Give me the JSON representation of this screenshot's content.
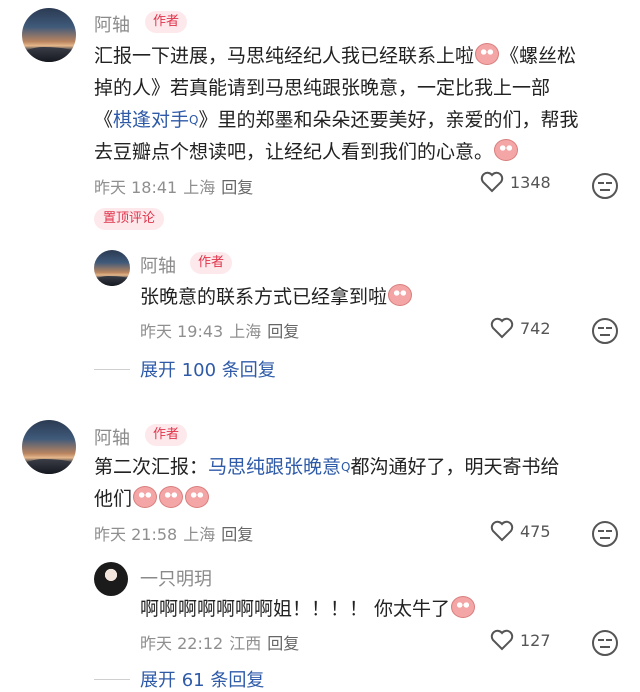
{
  "comments": [
    {
      "user": "阿轴",
      "badge": "作者",
      "text_before": "汇报一下进展，马思纯经纪人我已经联系上啦",
      "text_line2_a": "《螺丝松",
      "text_line2_b": "掉的人》若真能请到马思纯跟张晚意，一定比我上一部",
      "text_line3_a": "《",
      "text_link": "棋逢对手",
      "text_line3_b": "》里的郑墨和朵朵还要美好，亲爱的们，帮我",
      "text_line4": "去豆瓣点个想读吧，让经纪人看到我们的心意。",
      "meta": {
        "time": "昨天 18:41",
        "location": "上海",
        "reply": "回复"
      },
      "likes": "1348"
    },
    {
      "pinned_label": "置顶评论",
      "user": "阿轴",
      "badge": "作者",
      "text": "张晚意的联系方式已经拿到啦",
      "meta": {
        "time": "昨天 19:43",
        "location": "上海",
        "reply": "回复"
      },
      "likes": "742"
    },
    {
      "expand": "展开 100 条回复"
    },
    {
      "user": "阿轴",
      "badge": "作者",
      "text_a": "第二次汇报：",
      "text_link": "马思纯跟张晚意",
      "text_b": "都沟通好了，明天寄书给",
      "text_line2": "他们",
      "meta": {
        "time": "昨天 21:58",
        "location": "上海",
        "reply": "回复"
      },
      "likes": "475"
    },
    {
      "user": "一只明玥",
      "text": "啊啊啊啊啊啊啊姐！！！！ 你太牛了",
      "meta": {
        "time": "昨天 22:12",
        "location": "江西",
        "reply": "回复"
      },
      "likes": "127"
    },
    {
      "expand": "展开 61 条回复"
    }
  ],
  "icons": {
    "like": "heart-icon",
    "dislike": "face-icon",
    "sticker": "pig-emoji-icon"
  },
  "colors": {
    "link": "#2e5aa8",
    "badge": "#e0344b",
    "meta": "#8f8f8f"
  }
}
